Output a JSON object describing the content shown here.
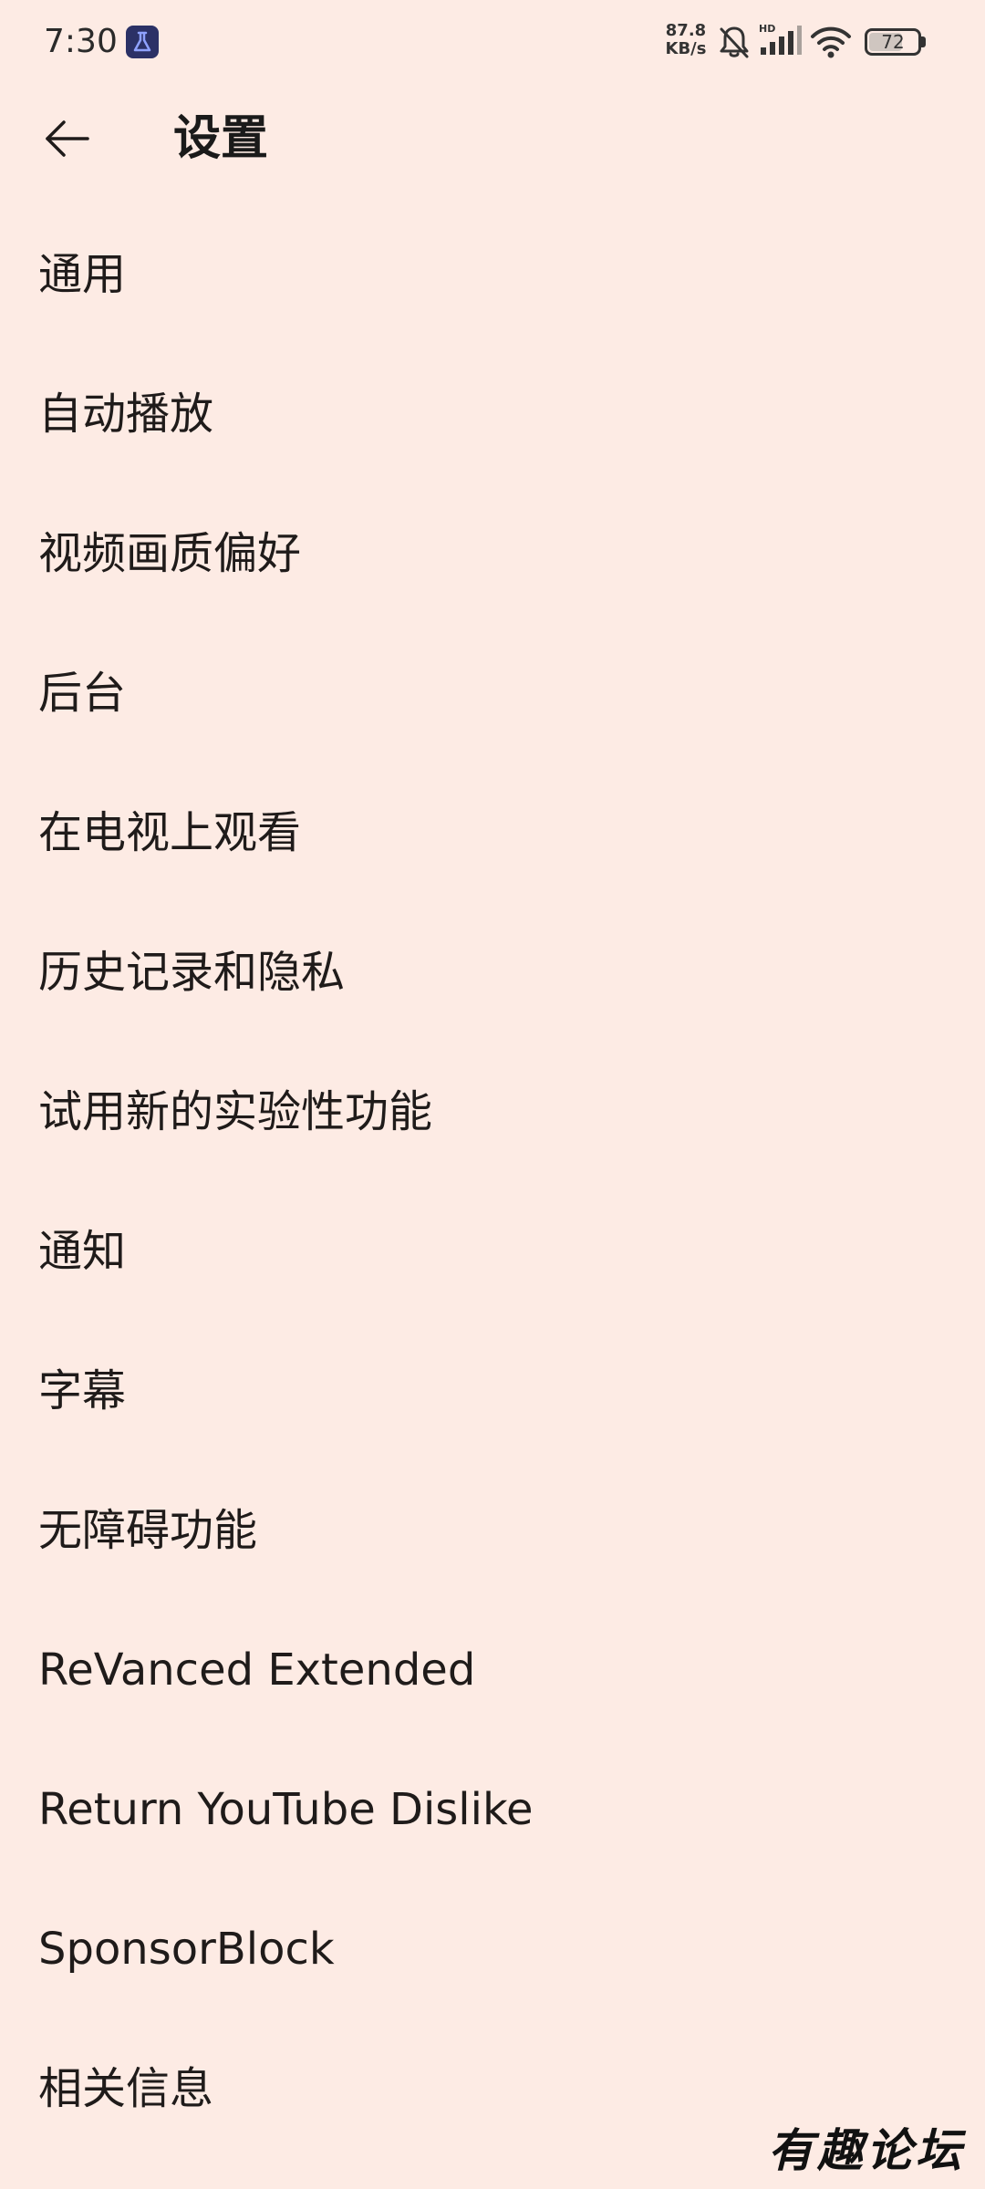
{
  "colors": {
    "background": "#fdebe4",
    "text": "#1f1b1a",
    "status_icon": "#333333",
    "app_icon_bg": "#2b3166"
  },
  "status_bar": {
    "time": "7:30",
    "app_icon": "flask-icon",
    "net_speed_value": "87.8",
    "net_speed_unit": "KB/s",
    "icons": [
      "bell-off-icon",
      "hd-signal-icon",
      "wifi-icon"
    ],
    "battery_level": "72",
    "battery_fraction": 0.72
  },
  "app_bar": {
    "back_icon": "arrow-left-icon",
    "title": "设置"
  },
  "settings": {
    "items": [
      {
        "label": "通用"
      },
      {
        "label": "自动播放"
      },
      {
        "label": "视频画质偏好"
      },
      {
        "label": "后台"
      },
      {
        "label": "在电视上观看"
      },
      {
        "label": "历史记录和隐私"
      },
      {
        "label": "试用新的实验性功能"
      },
      {
        "label": "通知"
      },
      {
        "label": "字幕"
      },
      {
        "label": "无障碍功能"
      },
      {
        "label": "ReVanced Extended"
      },
      {
        "label": "Return YouTube Dislike"
      },
      {
        "label": "SponsorBlock"
      },
      {
        "label": "相关信息"
      }
    ]
  },
  "watermark": {
    "text": "有趣论坛"
  }
}
